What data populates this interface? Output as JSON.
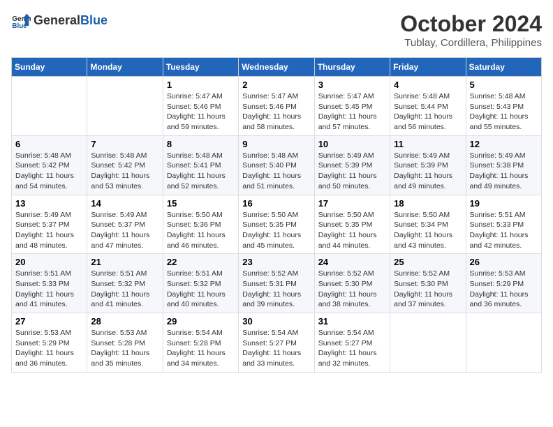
{
  "header": {
    "logo_line1": "General",
    "logo_line2": "Blue",
    "month": "October 2024",
    "location": "Tublay, Cordillera, Philippines"
  },
  "weekdays": [
    "Sunday",
    "Monday",
    "Tuesday",
    "Wednesday",
    "Thursday",
    "Friday",
    "Saturday"
  ],
  "weeks": [
    [
      {
        "day": "",
        "info": ""
      },
      {
        "day": "",
        "info": ""
      },
      {
        "day": "1",
        "info": "Sunrise: 5:47 AM\nSunset: 5:46 PM\nDaylight: 11 hours and 59 minutes."
      },
      {
        "day": "2",
        "info": "Sunrise: 5:47 AM\nSunset: 5:46 PM\nDaylight: 11 hours and 58 minutes."
      },
      {
        "day": "3",
        "info": "Sunrise: 5:47 AM\nSunset: 5:45 PM\nDaylight: 11 hours and 57 minutes."
      },
      {
        "day": "4",
        "info": "Sunrise: 5:48 AM\nSunset: 5:44 PM\nDaylight: 11 hours and 56 minutes."
      },
      {
        "day": "5",
        "info": "Sunrise: 5:48 AM\nSunset: 5:43 PM\nDaylight: 11 hours and 55 minutes."
      }
    ],
    [
      {
        "day": "6",
        "info": "Sunrise: 5:48 AM\nSunset: 5:42 PM\nDaylight: 11 hours and 54 minutes."
      },
      {
        "day": "7",
        "info": "Sunrise: 5:48 AM\nSunset: 5:42 PM\nDaylight: 11 hours and 53 minutes."
      },
      {
        "day": "8",
        "info": "Sunrise: 5:48 AM\nSunset: 5:41 PM\nDaylight: 11 hours and 52 minutes."
      },
      {
        "day": "9",
        "info": "Sunrise: 5:48 AM\nSunset: 5:40 PM\nDaylight: 11 hours and 51 minutes."
      },
      {
        "day": "10",
        "info": "Sunrise: 5:49 AM\nSunset: 5:39 PM\nDaylight: 11 hours and 50 minutes."
      },
      {
        "day": "11",
        "info": "Sunrise: 5:49 AM\nSunset: 5:39 PM\nDaylight: 11 hours and 49 minutes."
      },
      {
        "day": "12",
        "info": "Sunrise: 5:49 AM\nSunset: 5:38 PM\nDaylight: 11 hours and 49 minutes."
      }
    ],
    [
      {
        "day": "13",
        "info": "Sunrise: 5:49 AM\nSunset: 5:37 PM\nDaylight: 11 hours and 48 minutes."
      },
      {
        "day": "14",
        "info": "Sunrise: 5:49 AM\nSunset: 5:37 PM\nDaylight: 11 hours and 47 minutes."
      },
      {
        "day": "15",
        "info": "Sunrise: 5:50 AM\nSunset: 5:36 PM\nDaylight: 11 hours and 46 minutes."
      },
      {
        "day": "16",
        "info": "Sunrise: 5:50 AM\nSunset: 5:35 PM\nDaylight: 11 hours and 45 minutes."
      },
      {
        "day": "17",
        "info": "Sunrise: 5:50 AM\nSunset: 5:35 PM\nDaylight: 11 hours and 44 minutes."
      },
      {
        "day": "18",
        "info": "Sunrise: 5:50 AM\nSunset: 5:34 PM\nDaylight: 11 hours and 43 minutes."
      },
      {
        "day": "19",
        "info": "Sunrise: 5:51 AM\nSunset: 5:33 PM\nDaylight: 11 hours and 42 minutes."
      }
    ],
    [
      {
        "day": "20",
        "info": "Sunrise: 5:51 AM\nSunset: 5:33 PM\nDaylight: 11 hours and 41 minutes."
      },
      {
        "day": "21",
        "info": "Sunrise: 5:51 AM\nSunset: 5:32 PM\nDaylight: 11 hours and 41 minutes."
      },
      {
        "day": "22",
        "info": "Sunrise: 5:51 AM\nSunset: 5:32 PM\nDaylight: 11 hours and 40 minutes."
      },
      {
        "day": "23",
        "info": "Sunrise: 5:52 AM\nSunset: 5:31 PM\nDaylight: 11 hours and 39 minutes."
      },
      {
        "day": "24",
        "info": "Sunrise: 5:52 AM\nSunset: 5:30 PM\nDaylight: 11 hours and 38 minutes."
      },
      {
        "day": "25",
        "info": "Sunrise: 5:52 AM\nSunset: 5:30 PM\nDaylight: 11 hours and 37 minutes."
      },
      {
        "day": "26",
        "info": "Sunrise: 5:53 AM\nSunset: 5:29 PM\nDaylight: 11 hours and 36 minutes."
      }
    ],
    [
      {
        "day": "27",
        "info": "Sunrise: 5:53 AM\nSunset: 5:29 PM\nDaylight: 11 hours and 36 minutes."
      },
      {
        "day": "28",
        "info": "Sunrise: 5:53 AM\nSunset: 5:28 PM\nDaylight: 11 hours and 35 minutes."
      },
      {
        "day": "29",
        "info": "Sunrise: 5:54 AM\nSunset: 5:28 PM\nDaylight: 11 hours and 34 minutes."
      },
      {
        "day": "30",
        "info": "Sunrise: 5:54 AM\nSunset: 5:27 PM\nDaylight: 11 hours and 33 minutes."
      },
      {
        "day": "31",
        "info": "Sunrise: 5:54 AM\nSunset: 5:27 PM\nDaylight: 11 hours and 32 minutes."
      },
      {
        "day": "",
        "info": ""
      },
      {
        "day": "",
        "info": ""
      }
    ]
  ]
}
